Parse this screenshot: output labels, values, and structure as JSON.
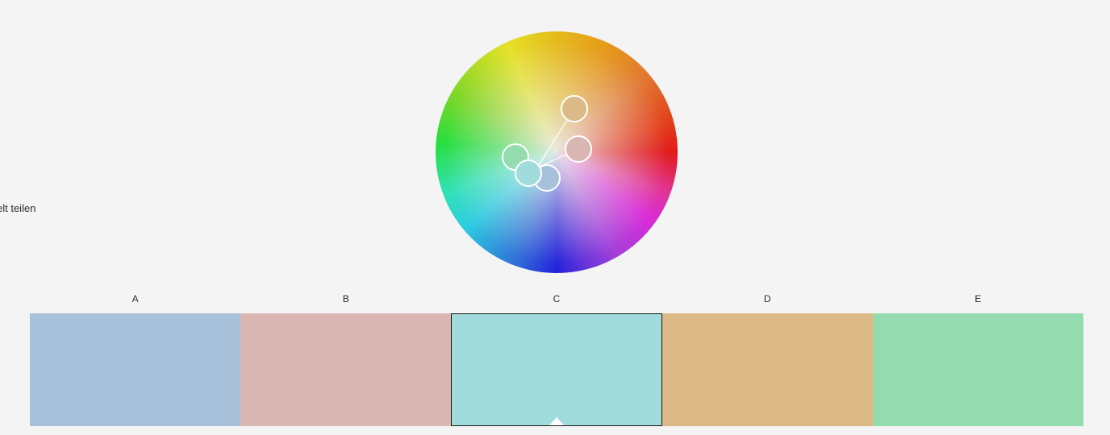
{
  "side_text": "elt teilen",
  "swatches": [
    {
      "label": "A",
      "color": "#a8c1db",
      "active": false
    },
    {
      "label": "B",
      "color": "#dab6b3",
      "active": false
    },
    {
      "label": "C",
      "color": "#a1dbdb",
      "active": true
    },
    {
      "label": "D",
      "color": "#dbba87",
      "active": false
    },
    {
      "label": "E",
      "color": "#94dbaf",
      "active": false
    }
  ],
  "icons": {
    "caret": "active-swatch-caret-icon"
  }
}
